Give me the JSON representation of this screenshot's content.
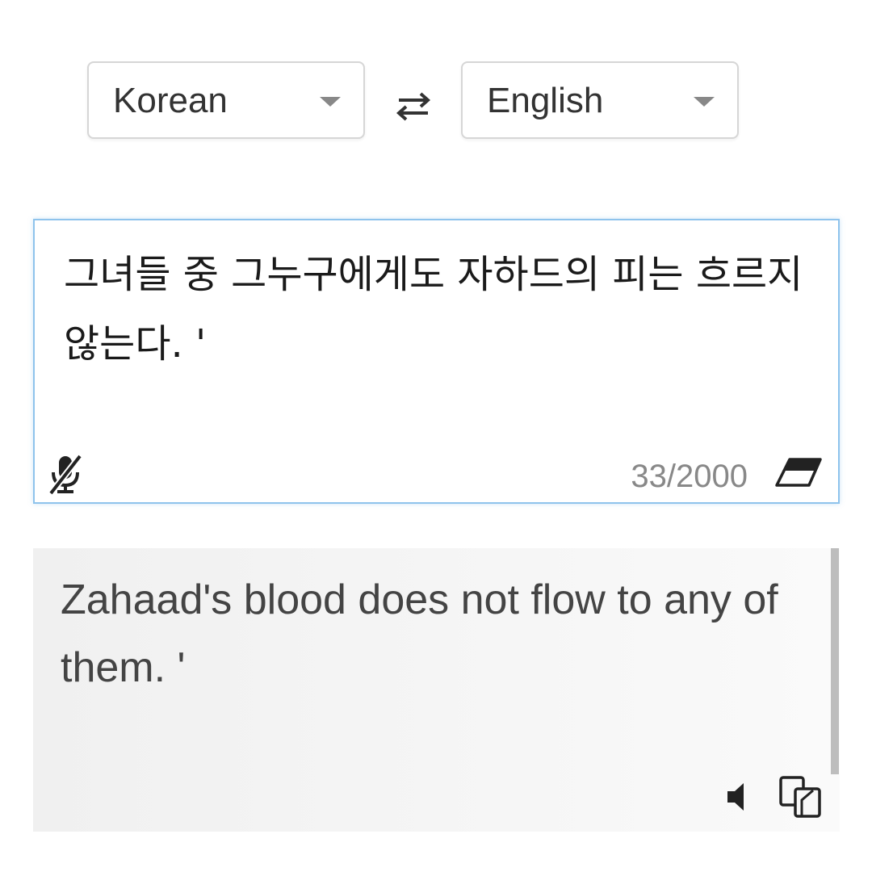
{
  "language_bar": {
    "source_language": "Korean",
    "target_language": "English",
    "swap_icon": "swap-arrows-icon"
  },
  "source": {
    "text": "그녀들 중 그누구에게도 자하드의 피는 흐르지 않는다. '",
    "char_count": "33/2000",
    "mic_icon": "mic-off-icon",
    "clear_icon": "eraser-icon"
  },
  "result": {
    "text": "Zahaad's blood does not flow to any of them. '",
    "speaker_icon": "speaker-icon",
    "copy_icon": "copy-icon"
  },
  "colors": {
    "source_border": "#8ec3ec",
    "result_background": "#f3f3f3",
    "muted_text": "#888888"
  }
}
